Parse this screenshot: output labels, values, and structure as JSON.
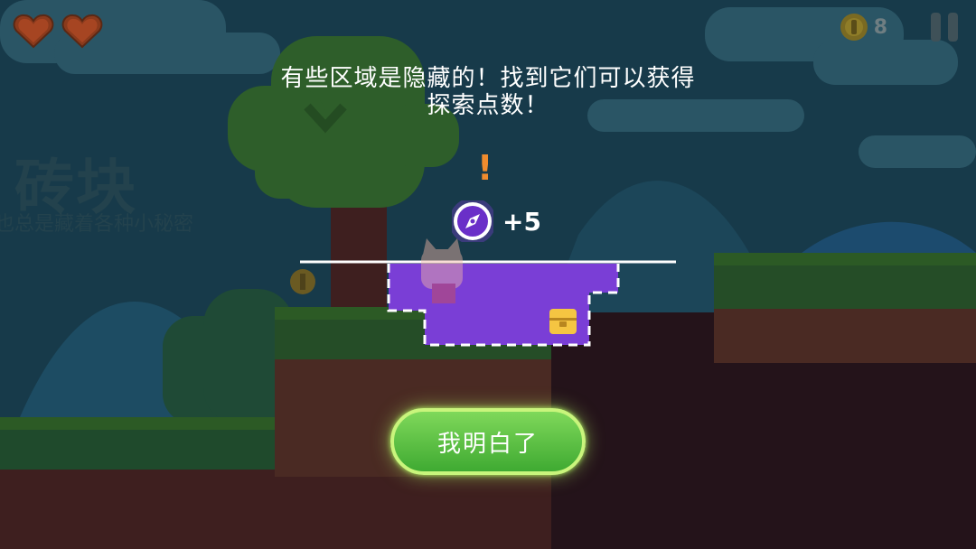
{
  "hud": {
    "hearts": [
      {
        "icon": "heart-icon",
        "state": "full"
      },
      {
        "icon": "heart-icon",
        "state": "full"
      }
    ],
    "coin_icon": "coin-icon",
    "coin_count": "8",
    "pause_icon": "pause-icon"
  },
  "tutorial": {
    "line1": "有些区域是隐藏的！找到它们可以获得",
    "line2": "探索点数！",
    "alert_icon": "exclamation-icon",
    "reward_icon": "compass-icon",
    "reward_value": "+5",
    "confirm_label": "我明白了"
  },
  "background_sign": {
    "title": "砖块",
    "subtitle": "也总是藏着各种小秘密"
  },
  "colors": {
    "hidden_area": "#7a3ed6",
    "button": "#4fbf3a",
    "button_glow": "#c9f57c",
    "alert": "#f08c2e",
    "heart": "#8a3a1c",
    "chest": "#f5c542"
  }
}
